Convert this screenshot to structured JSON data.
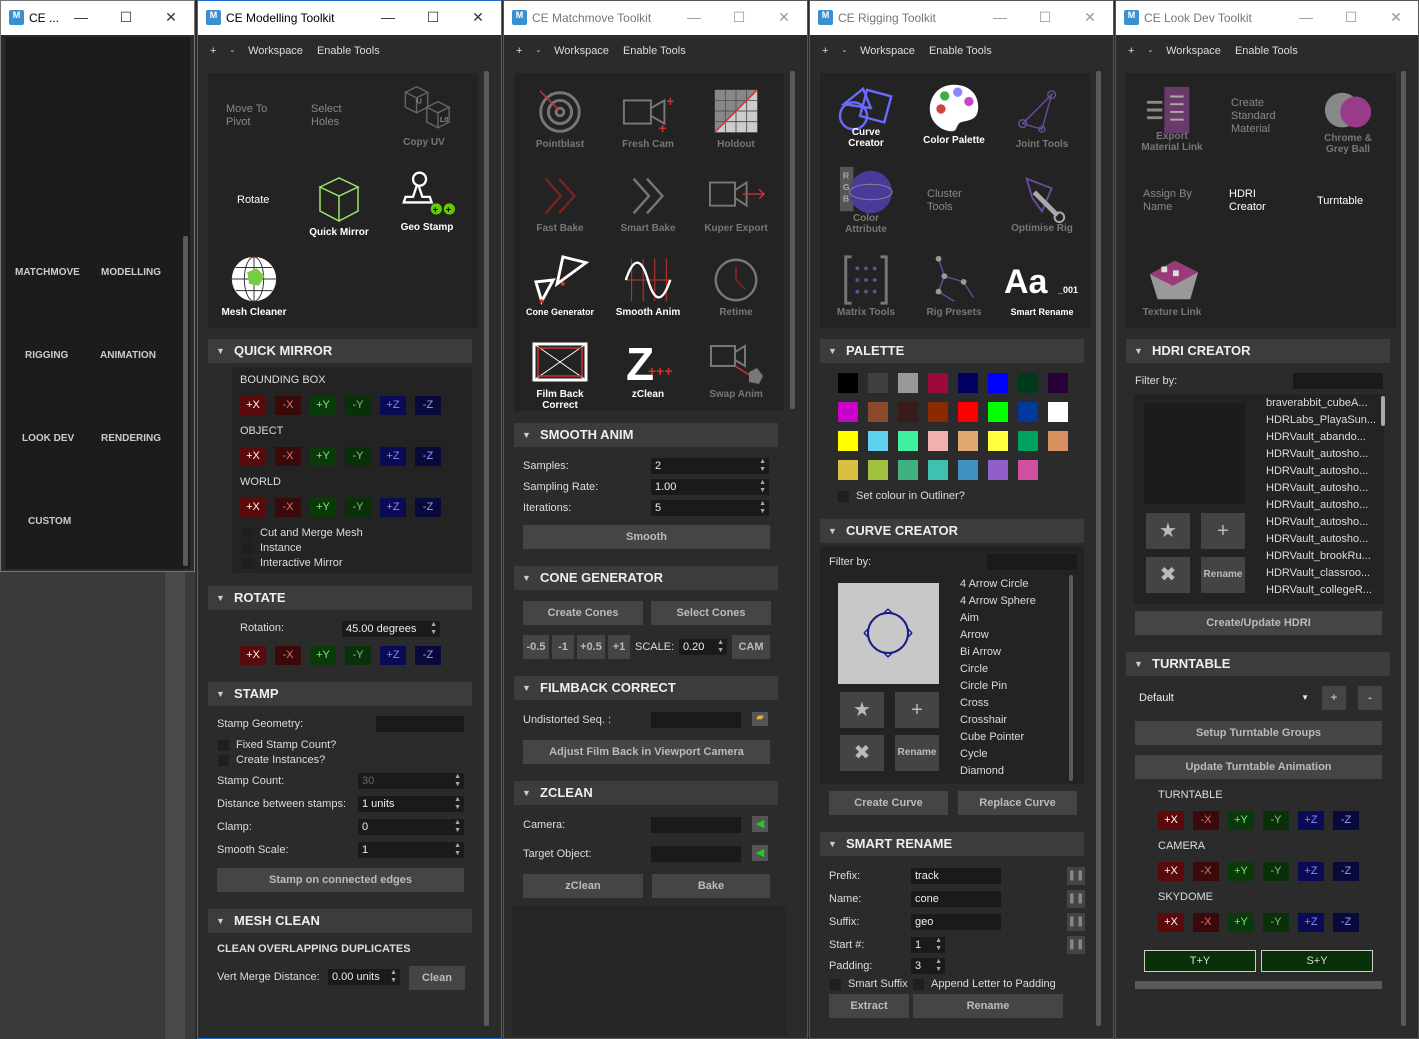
{
  "sidebar": {
    "title": "CE ...",
    "items": [
      "MATCHMOVE",
      "MODELLING",
      "RIGGING",
      "ANIMATION",
      "LOOK DEV",
      "RENDERING",
      "CUSTOM"
    ]
  },
  "menu": {
    "plus": "+",
    "minus": "-",
    "workspace": "Workspace",
    "enable_tools": "Enable Tools"
  },
  "modelling": {
    "title": "CE Modelling Toolkit",
    "tools": {
      "move_to_pivot": "Move To Pivot",
      "select_holes": "Select Holes",
      "copy_uv": "Copy UV",
      "rotate": "Rotate",
      "quick_mirror": "Quick Mirror",
      "geo_stamp": "Geo Stamp",
      "mesh_cleaner": "Mesh Cleaner"
    },
    "quick_mirror": {
      "header": "QUICK MIRROR",
      "bounding_box": "BOUNDING BOX",
      "object": "OBJECT",
      "world": "WORLD",
      "cut_merge": "Cut and Merge Mesh",
      "instance": "Instance",
      "interactive": "Interactive Mirror"
    },
    "axes": {
      "px": "+X",
      "nx": "-X",
      "py": "+Y",
      "ny": "-Y",
      "pz": "+Z",
      "nz": "-Z"
    },
    "rotate": {
      "header": "ROTATE",
      "label": "Rotation:",
      "value": "45.00 degrees"
    },
    "stamp": {
      "header": "STAMP",
      "geometry": "Stamp Geometry:",
      "fixed": "Fixed Stamp Count?",
      "create_inst": "Create Instances?",
      "count_label": "Stamp Count:",
      "count": "30",
      "dist_label": "Distance between stamps:",
      "dist": "1 units",
      "clamp_label": "Clamp:",
      "clamp": "0",
      "smooth_label": "Smooth Scale:",
      "smooth": "1",
      "button": "Stamp on connected edges"
    },
    "mesh_clean": {
      "header": "MESH CLEAN",
      "sub": "CLEAN OVERLAPPING DUPLICATES",
      "vert_label": "Vert Merge Distance:",
      "vert": "0.00 units",
      "button": "Clean"
    }
  },
  "matchmove": {
    "title": "CE Matchmove Toolkit",
    "tools": {
      "pointblast": "Pointblast",
      "fresh_cam": "Fresh Cam",
      "holdout": "Holdout",
      "fast_bake": "Fast Bake",
      "smart_bake": "Smart Bake",
      "kuper_export": "Kuper Export",
      "cone_generator": "Cone Generator",
      "smooth_anim": "Smooth Anim",
      "retime": "Retime",
      "film_back": "Film Back Correct",
      "zclean": "zClean",
      "swap_anim": "Swap Anim"
    },
    "smooth_anim": {
      "header": "SMOOTH ANIM",
      "samples_label": "Samples:",
      "samples": "2",
      "rate_label": "Sampling Rate:",
      "rate": "1.00",
      "iter_label": "Iterations:",
      "iter": "5",
      "button": "Smooth"
    },
    "cone": {
      "header": "CONE GENERATOR",
      "create": "Create Cones",
      "select": "Select Cones",
      "m05": "-0.5",
      "m1": "-1",
      "p05": "+0.5",
      "p1": "+1",
      "scale_label": "SCALE:",
      "scale": "0.20",
      "cam": "CAM"
    },
    "filmback": {
      "header": "FILMBACK CORRECT",
      "seq_label": "Undistorted Seq. :",
      "button": "Adjust Film Back in Viewport Camera"
    },
    "zclean": {
      "header": "ZCLEAN",
      "camera_label": "Camera:",
      "target_label": "Target Object:",
      "zclean": "zClean",
      "bake": "Bake"
    }
  },
  "rigging": {
    "title": "CE Rigging Toolkit",
    "tools": {
      "curve_creator": "Curve Creator",
      "color_palette": "Color Palette",
      "joint_tools": "Joint Tools",
      "color_attribute": "Color Attribute",
      "cluster_tools": "Cluster Tools",
      "optimise_rig": "Optimise Rig",
      "matrix_tools": "Matrix Tools",
      "rig_presets": "Rig Presets",
      "smart_rename": "Smart Rename",
      "aa": "Aa",
      "aa_sub": "_001"
    },
    "palette": {
      "header": "PALETTE",
      "outliner": "Set colour in Outliner?"
    },
    "curve": {
      "header": "CURVE CREATOR",
      "filter": "Filter by:",
      "items": [
        "4 Arrow Circle",
        "4 Arrow Sphere",
        "Aim",
        "Arrow",
        "Bi Arrow",
        "Circle",
        "Circle Pin",
        "Cross",
        "Crosshair",
        "Cube Pointer",
        "Cycle",
        "Diamond"
      ],
      "rename": "Rename",
      "create": "Create Curve",
      "replace": "Replace Curve"
    },
    "rename": {
      "header": "SMART RENAME",
      "prefix_label": "Prefix:",
      "prefix": "track",
      "name_label": "Name:",
      "name": "cone",
      "suffix_label": "Suffix:",
      "suffix": "geo",
      "start_label": "Start #:",
      "start": "1",
      "padding_label": "Padding:",
      "padding": "3",
      "smart_suffix": "Smart Suffix",
      "append": "Append Letter to Padding",
      "extract": "Extract",
      "rename": "Rename"
    }
  },
  "palette_colors": [
    "#000000",
    "#404040",
    "#999999",
    "#9b0a3a",
    "#000060",
    "#0000ff",
    "#003a1a",
    "#2a003a",
    "#c800c8",
    "#8a4a2a",
    "#3a1a1a",
    "#8a2a00",
    "#ff0000",
    "#00ff00",
    "#003a9a",
    "#ffffff",
    "#ffff00",
    "#60d0f0",
    "#40f0a0",
    "#f0b0b0",
    "#e0a870",
    "#ffff40",
    "#00a060",
    "#d89060",
    "#d8c040",
    "#a0c040",
    "#40b080",
    "#40c0b0",
    "#4090c0",
    "#9060c8",
    "#d050a0"
  ],
  "lookdev": {
    "title": "CE Look Dev Toolkit",
    "tools": {
      "export_link": "Export Material Link",
      "standard_material": "Create Standard Material",
      "chrome_ball": "Chrome & Grey Ball",
      "assign_by_name": "Assign By Name",
      "hdri_creator": "HDRI Creator",
      "turntable": "Turntable",
      "texture_link": "Texture Link"
    },
    "hdri": {
      "header": "HDRI CREATOR",
      "filter": "Filter by:",
      "items": [
        "braverabbit_cubeA...",
        "HDRLabs_PlayaSun...",
        "HDRVault_abando...",
        "HDRVault_autosho...",
        "HDRVault_autosho...",
        "HDRVault_autosho...",
        "HDRVault_autosho...",
        "HDRVault_autosho...",
        "HDRVault_autosho...",
        "HDRVault_brookRu...",
        "HDRVault_classroo...",
        "HDRVault_collegeR..."
      ],
      "rename": "Rename",
      "button": "Create/Update HDRI"
    },
    "turntable": {
      "header": "TURNTABLE",
      "select": "Default",
      "plus": "+",
      "minus": "-",
      "setup": "Setup Turntable Groups",
      "update": "Update Turntable Animation",
      "turntable": "TURNTABLE",
      "camera": "CAMERA",
      "skydome": "SKYDOME",
      "ty": "T+Y",
      "sy": "S+Y"
    }
  }
}
